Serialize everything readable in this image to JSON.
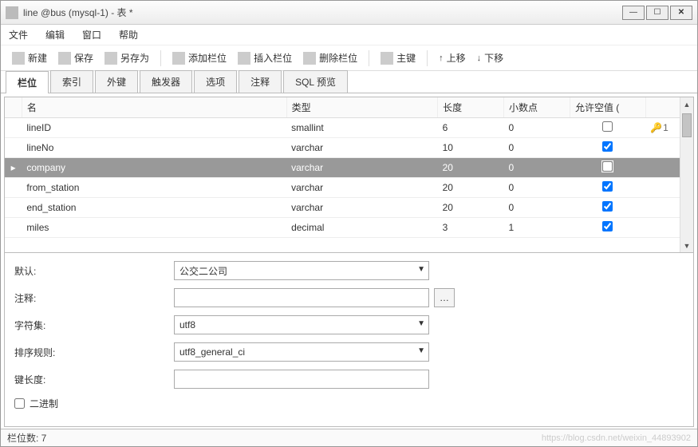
{
  "window": {
    "title": "line @bus (mysql-1) - 表 *"
  },
  "menu": {
    "file": "文件",
    "edit": "编辑",
    "window": "窗口",
    "help": "帮助"
  },
  "toolbar": {
    "new": "新建",
    "save": "保存",
    "saveas": "另存为",
    "addcol": "添加栏位",
    "insertcol": "插入栏位",
    "delcol": "删除栏位",
    "pk": "主键",
    "up": "上移",
    "down": "下移"
  },
  "tabs": {
    "fields": "栏位",
    "indexes": "索引",
    "fk": "外键",
    "triggers": "触发器",
    "options": "选项",
    "comment": "注释",
    "sqlpreview": "SQL 预览"
  },
  "grid": {
    "headers": {
      "name": "名",
      "type": "类型",
      "length": "长度",
      "decimals": "小数点",
      "allownull": "允许空值 ("
    },
    "rows": [
      {
        "name": "lineID",
        "type": "smallint",
        "length": "6",
        "decimals": "0",
        "allownull": false,
        "pk": "1",
        "selected": false
      },
      {
        "name": "lineNo",
        "type": "varchar",
        "length": "10",
        "decimals": "0",
        "allownull": true,
        "pk": "",
        "selected": false
      },
      {
        "name": "company",
        "type": "varchar",
        "length": "20",
        "decimals": "0",
        "allownull": false,
        "pk": "",
        "selected": true
      },
      {
        "name": "from_station",
        "type": "varchar",
        "length": "20",
        "decimals": "0",
        "allownull": true,
        "pk": "",
        "selected": false
      },
      {
        "name": "end_station",
        "type": "varchar",
        "length": "20",
        "decimals": "0",
        "allownull": true,
        "pk": "",
        "selected": false
      },
      {
        "name": "miles",
        "type": "decimal",
        "length": "3",
        "decimals": "1",
        "allownull": true,
        "pk": "",
        "selected": false
      }
    ]
  },
  "form": {
    "default_label": "默认:",
    "default_value": "公交二公司",
    "comment_label": "注释:",
    "comment_value": "",
    "charset_label": "字符集:",
    "charset_value": "utf8",
    "collation_label": "排序规则:",
    "collation_value": "utf8_general_ci",
    "keylen_label": "键长度:",
    "keylen_value": "",
    "binary_label": "二进制"
  },
  "status": {
    "fields": "栏位数: 7"
  },
  "watermark": "https://blog.csdn.net/weixin_44893902"
}
